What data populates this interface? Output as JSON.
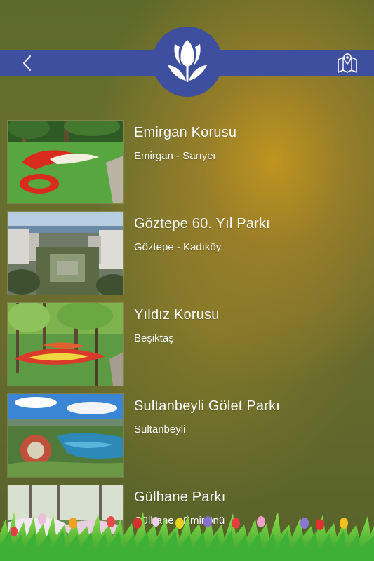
{
  "header": {
    "back_icon": "chevron-left-icon",
    "logo_icon": "tulip-icon",
    "map_icon": "map-pin-icon",
    "bar_color": "#3f4f9f"
  },
  "parks": [
    {
      "name": "Emirgan Korusu",
      "district": "Emirgan - Sarıyer"
    },
    {
      "name": "Göztepe 60. Yıl Parkı",
      "district": "Göztepe - Kadıköy"
    },
    {
      "name": "Yıldız Korusu",
      "district": "Beşiktaş"
    },
    {
      "name": "Sultanbeyli Gölet Parkı",
      "district": "Sultanbeyli"
    },
    {
      "name": "Gülhane Parkı",
      "district": "Gülhane - Eminönü"
    }
  ]
}
